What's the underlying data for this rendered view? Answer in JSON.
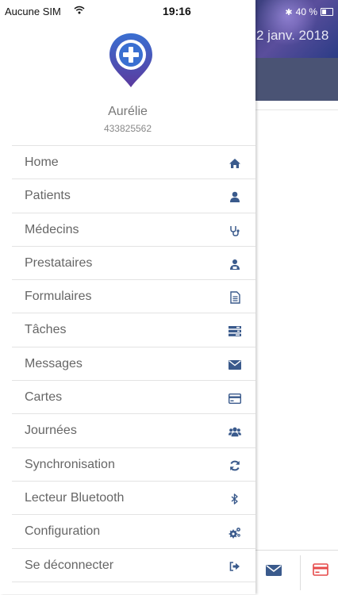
{
  "status_bar": {
    "carrier": "Aucune SIM",
    "time": "19:16",
    "battery": "40 %"
  },
  "background_app": {
    "date": "2 janv. 2018"
  },
  "profile": {
    "name": "Aurélie",
    "id": "433825562"
  },
  "menu": {
    "items": [
      {
        "label": "Home",
        "icon": "home-icon"
      },
      {
        "label": "Patients",
        "icon": "user-icon"
      },
      {
        "label": "Médecins",
        "icon": "stethoscope-icon"
      },
      {
        "label": "Prestataires",
        "icon": "user-group-icon"
      },
      {
        "label": "Formulaires",
        "icon": "document-icon"
      },
      {
        "label": "Tâches",
        "icon": "tasks-icon"
      },
      {
        "label": "Messages",
        "icon": "envelope-icon"
      },
      {
        "label": "Cartes",
        "icon": "credit-card-icon"
      },
      {
        "label": "Journées",
        "icon": "users-icon"
      },
      {
        "label": "Synchronisation",
        "icon": "refresh-icon"
      },
      {
        "label": "Lecteur Bluetooth",
        "icon": "bluetooth-icon"
      },
      {
        "label": "Configuration",
        "icon": "gears-icon"
      },
      {
        "label": "Se déconnecter",
        "icon": "sign-out-icon"
      }
    ]
  },
  "colors": {
    "icon": "#3a5a8c",
    "logo_blue": "#3a6fd1",
    "logo_purple": "#5b3a9e",
    "text": "#666666",
    "divider": "#e3e3e3",
    "accent_red": "#e64a4a"
  }
}
